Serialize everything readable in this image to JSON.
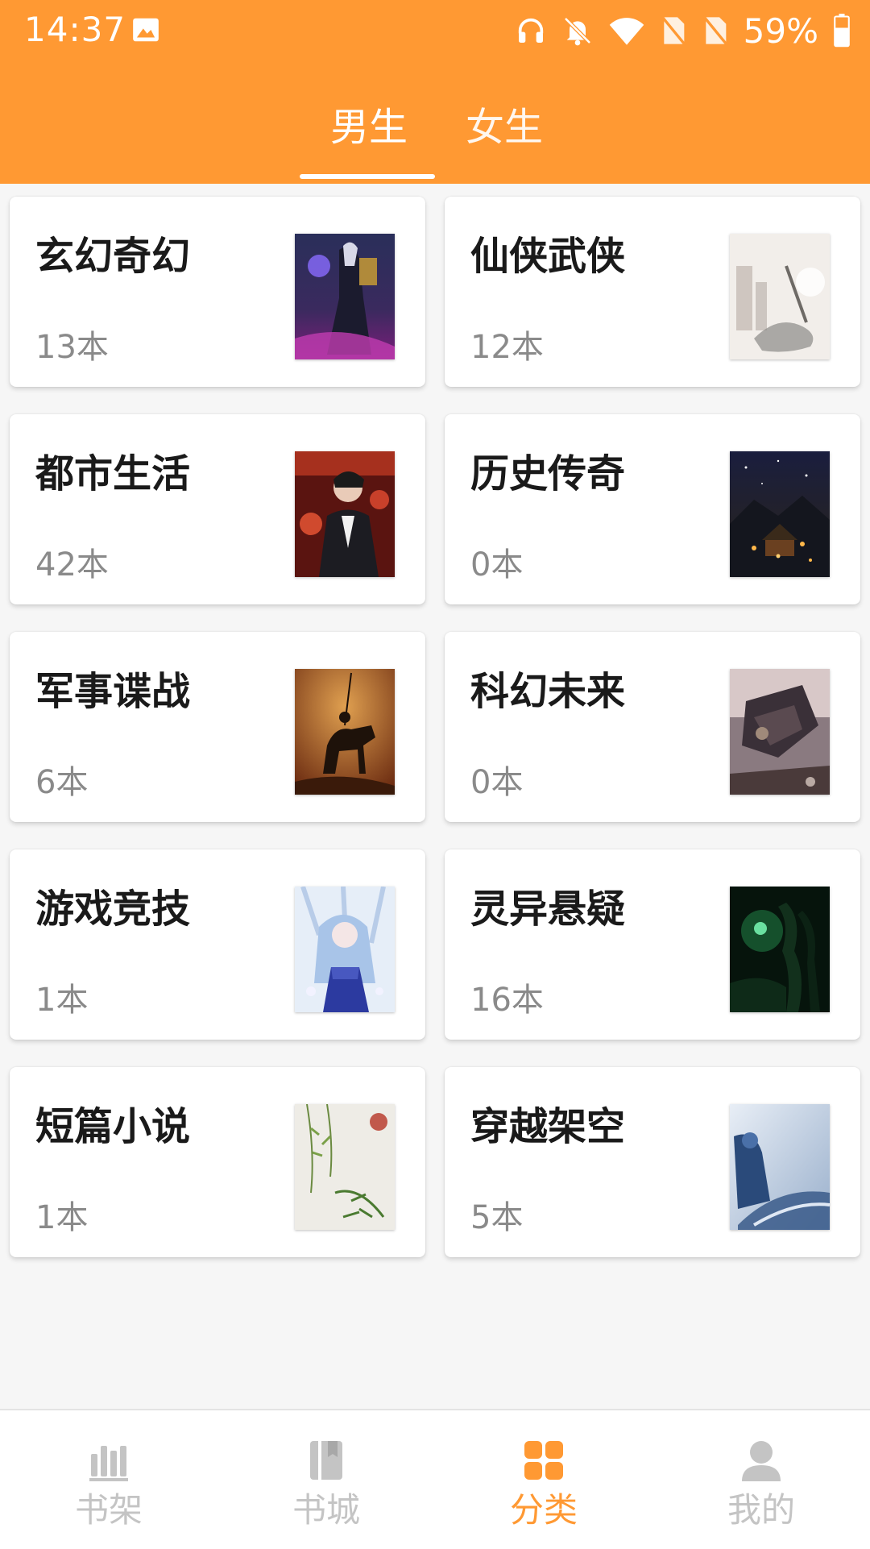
{
  "status_bar": {
    "time": "14:37",
    "battery": "59%",
    "icons": [
      "gallery-icon",
      "headset-icon",
      "bell-off-icon",
      "wifi-icon",
      "no-sim-icon",
      "no-sim-icon",
      "battery-icon"
    ]
  },
  "tabs": [
    {
      "label": "男生",
      "active": true
    },
    {
      "label": "女生",
      "active": false
    }
  ],
  "categories": [
    {
      "title": "玄幻奇幻",
      "count": "13本",
      "cover": "dark-fantasy-warrior"
    },
    {
      "title": "仙侠武侠",
      "count": "12本",
      "cover": "misty-dragon"
    },
    {
      "title": "都市生活",
      "count": "42本",
      "cover": "man-in-suit"
    },
    {
      "title": "历史传奇",
      "count": "0本",
      "cover": "night-palace"
    },
    {
      "title": "军事谍战",
      "count": "6本",
      "cover": "horse-rider"
    },
    {
      "title": "科幻未来",
      "count": "0本",
      "cover": "sci-fi-ship"
    },
    {
      "title": "游戏竞技",
      "count": "1本",
      "cover": "anime-girl-blue"
    },
    {
      "title": "灵异悬疑",
      "count": "16本",
      "cover": "green-forest"
    },
    {
      "title": "短篇小说",
      "count": "1本",
      "cover": "bamboo-ink"
    },
    {
      "title": "穿越架空",
      "count": "5本",
      "cover": "snow-warrior"
    }
  ],
  "bottom_nav": [
    {
      "label": "书架",
      "icon": "bookshelf-icon",
      "active": false
    },
    {
      "label": "书城",
      "icon": "bookstore-icon",
      "active": false
    },
    {
      "label": "分类",
      "icon": "category-grid-icon",
      "active": true
    },
    {
      "label": "我的",
      "icon": "profile-icon",
      "active": false
    }
  ],
  "colors": {
    "accent": "#FF9933",
    "inactive_nav": "#C4C4C4",
    "count_text": "#8A8A8A"
  }
}
